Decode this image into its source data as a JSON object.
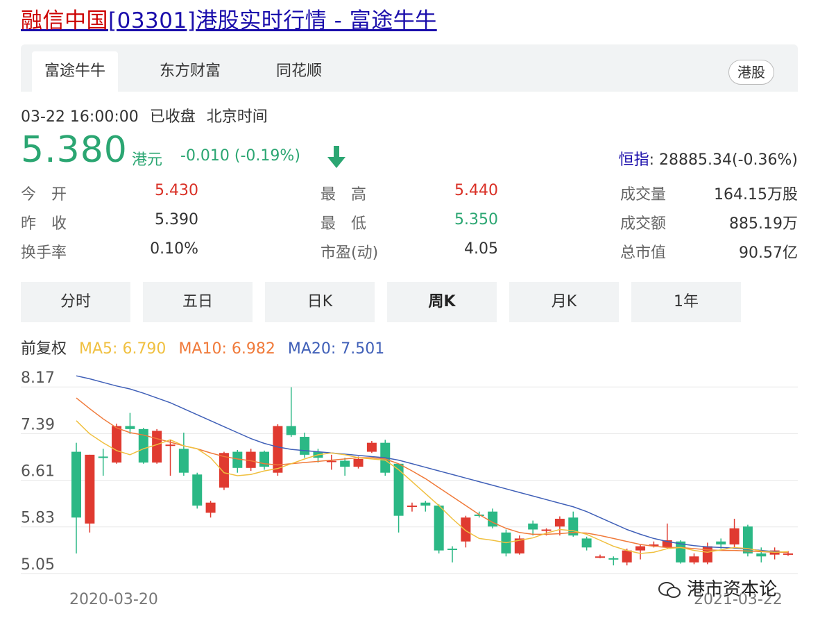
{
  "title": {
    "stock_name": "融信中国",
    "code": "[03301]",
    "rest": "港股实时行情 - 富途牛牛"
  },
  "source_tabs": [
    {
      "label": "富途牛牛",
      "active": true
    },
    {
      "label": "东方财富",
      "active": false
    },
    {
      "label": "同花顺",
      "active": false
    }
  ],
  "market_badge": "港股",
  "status": {
    "datetime": "03-22 16:00:00",
    "state": "已收盘",
    "tz": "北京时间"
  },
  "quote": {
    "price": "5.380",
    "unit": "港元",
    "change": "-0.010 (-0.19%)",
    "direction": "down"
  },
  "index": {
    "name": "恒指",
    "value": ": 28885.34(-0.36%)"
  },
  "stats": [
    {
      "label": "今　开",
      "value": "5.430",
      "tone": "red"
    },
    {
      "label": "最　高",
      "value": "5.440",
      "tone": "red"
    },
    {
      "label": "成交量",
      "value": "164.15万股",
      "tone": "normal"
    },
    {
      "label": "昨　收",
      "value": "5.390",
      "tone": "normal"
    },
    {
      "label": "最　低",
      "value": "5.350",
      "tone": "green"
    },
    {
      "label": "成交额",
      "value": "885.19万",
      "tone": "normal"
    },
    {
      "label": "换手率",
      "value": "0.10%",
      "tone": "normal"
    },
    {
      "label": "市盈(动)",
      "value": "4.05",
      "tone": "normal"
    },
    {
      "label": "总市值",
      "value": "90.57亿",
      "tone": "normal"
    }
  ],
  "period_tabs": [
    {
      "label": "分时",
      "active": false
    },
    {
      "label": "五日",
      "active": false
    },
    {
      "label": "日K",
      "active": false
    },
    {
      "label": "周K",
      "active": true
    },
    {
      "label": "月K",
      "active": false
    },
    {
      "label": "1年",
      "active": false
    }
  ],
  "legend": {
    "adjust": "前复权",
    "ma5": "MA5: 6.790",
    "ma10": "MA10: 6.982",
    "ma20": "MA20: 7.501"
  },
  "colors": {
    "up": "#e03a30",
    "down": "#2bb885",
    "ma5": "#f0c040",
    "ma10": "#f07a3a",
    "ma20": "#4060b8",
    "accent_green": "#2ba672",
    "link": "#1a0dab"
  },
  "watermark": "港市资本论",
  "chart_data": {
    "type": "candlestick",
    "period": "weekly",
    "y_ticks": [
      "8.17",
      "7.39",
      "6.61",
      "5.83",
      "5.05"
    ],
    "ylim": [
      4.7,
      8.3
    ],
    "x_labels": {
      "start": "2020-03-20",
      "end": "2021-03-22"
    },
    "candles": [
      [
        6.9,
        5.8,
        7.05,
        5.2,
        "down"
      ],
      [
        5.7,
        6.85,
        6.85,
        5.55,
        "up"
      ],
      [
        6.82,
        6.82,
        6.95,
        6.5,
        "flat"
      ],
      [
        6.72,
        7.33,
        7.37,
        6.7,
        "up"
      ],
      [
        7.33,
        7.28,
        7.55,
        7.2,
        "down"
      ],
      [
        7.28,
        6.72,
        7.3,
        6.7,
        "down"
      ],
      [
        6.72,
        7.25,
        7.28,
        6.7,
        "up"
      ],
      [
        7.02,
        7.02,
        7.1,
        6.5,
        "flat"
      ],
      [
        6.95,
        6.55,
        7.22,
        6.5,
        "down"
      ],
      [
        6.52,
        6.0,
        6.55,
        5.95,
        "down"
      ],
      [
        5.88,
        6.05,
        6.08,
        5.8,
        "up"
      ],
      [
        6.3,
        6.88,
        6.9,
        6.26,
        "up"
      ],
      [
        6.9,
        6.63,
        6.93,
        6.55,
        "down"
      ],
      [
        6.63,
        6.9,
        6.95,
        6.58,
        "up"
      ],
      [
        6.9,
        6.65,
        6.92,
        6.6,
        "down"
      ],
      [
        6.55,
        7.33,
        7.36,
        6.5,
        "up"
      ],
      [
        7.33,
        7.18,
        7.98,
        7.15,
        "down"
      ],
      [
        7.15,
        6.85,
        7.22,
        6.8,
        "down"
      ],
      [
        6.9,
        6.8,
        6.95,
        6.72,
        "down"
      ],
      [
        6.75,
        6.75,
        6.85,
        6.6,
        "flat"
      ],
      [
        6.75,
        6.65,
        6.8,
        6.5,
        "down"
      ],
      [
        6.65,
        6.78,
        6.82,
        6.62,
        "up"
      ],
      [
        6.9,
        7.05,
        7.08,
        6.88,
        "up"
      ],
      [
        7.05,
        6.55,
        7.1,
        6.5,
        "down"
      ],
      [
        6.7,
        5.83,
        6.7,
        5.55,
        "down"
      ],
      [
        6.0,
        6.0,
        6.05,
        5.9,
        "flat"
      ],
      [
        6.05,
        6.0,
        6.08,
        5.9,
        "down"
      ],
      [
        6.0,
        5.25,
        6.02,
        5.2,
        "down"
      ],
      [
        5.28,
        5.28,
        5.32,
        5.05,
        "flat"
      ],
      [
        5.4,
        5.8,
        5.83,
        5.3,
        "up"
      ],
      [
        5.85,
        5.85,
        5.9,
        5.8,
        "flat"
      ],
      [
        5.9,
        5.65,
        5.95,
        5.62,
        "down"
      ],
      [
        5.55,
        5.2,
        5.6,
        5.15,
        "down"
      ],
      [
        5.2,
        5.45,
        5.5,
        5.18,
        "up"
      ],
      [
        5.7,
        5.6,
        5.75,
        5.5,
        "down"
      ],
      [
        5.6,
        5.6,
        5.62,
        5.5,
        "flat"
      ],
      [
        5.65,
        5.78,
        5.82,
        5.5,
        "up"
      ],
      [
        5.8,
        5.5,
        5.9,
        5.48,
        "down"
      ],
      [
        5.45,
        5.3,
        5.48,
        5.25,
        "down"
      ],
      [
        5.15,
        5.15,
        5.18,
        5.12,
        "flat"
      ],
      [
        5.12,
        5.12,
        5.15,
        5.0,
        "flat"
      ],
      [
        5.05,
        5.25,
        5.28,
        5.0,
        "up"
      ],
      [
        5.25,
        5.32,
        5.35,
        5.1,
        "up"
      ],
      [
        5.35,
        5.35,
        5.4,
        5.3,
        "flat"
      ],
      [
        5.3,
        5.42,
        5.7,
        5.28,
        "up"
      ],
      [
        5.4,
        5.05,
        5.42,
        5.03,
        "down"
      ],
      [
        5.05,
        5.15,
        5.2,
        5.02,
        "up"
      ],
      [
        5.05,
        5.32,
        5.38,
        5.02,
        "up"
      ],
      [
        5.35,
        5.4,
        5.45,
        5.28,
        "flat"
      ],
      [
        5.35,
        5.62,
        5.78,
        5.3,
        "up"
      ],
      [
        5.65,
        5.2,
        5.68,
        5.15,
        "down"
      ],
      [
        5.2,
        5.15,
        5.3,
        5.05,
        "down"
      ],
      [
        5.18,
        5.25,
        5.3,
        5.1,
        "up"
      ],
      [
        5.2,
        5.2,
        5.24,
        5.16,
        "flat"
      ]
    ],
    "ma5": [
      7.42,
      7.2,
      7.05,
      6.92,
      6.85,
      6.95,
      7.02,
      7.1,
      7.0,
      6.95,
      6.8,
      6.55,
      6.5,
      6.52,
      6.58,
      6.62,
      6.7,
      6.78,
      6.85,
      6.88,
      6.85,
      6.8,
      6.78,
      6.76,
      6.6,
      6.4,
      6.2,
      6.0,
      5.78,
      5.58,
      5.45,
      5.42,
      5.38,
      5.42,
      5.46,
      5.54,
      5.6,
      5.58,
      5.52,
      5.42,
      5.32,
      5.25,
      5.2,
      5.22,
      5.28,
      5.3,
      5.25,
      5.22,
      5.26,
      5.3,
      5.28,
      5.24,
      5.22,
      5.23
    ],
    "ma10": [
      7.8,
      7.62,
      7.45,
      7.3,
      7.22,
      7.18,
      7.12,
      7.06,
      7.0,
      6.95,
      6.88,
      6.82,
      6.78,
      6.75,
      6.7,
      6.68,
      6.7,
      6.72,
      6.74,
      6.76,
      6.78,
      6.8,
      6.8,
      6.78,
      6.7,
      6.58,
      6.45,
      6.3,
      6.15,
      6.0,
      5.85,
      5.72,
      5.62,
      5.55,
      5.52,
      5.52,
      5.53,
      5.55,
      5.54,
      5.5,
      5.45,
      5.4,
      5.35,
      5.32,
      5.3,
      5.3,
      5.28,
      5.26,
      5.25,
      5.25,
      5.24,
      5.23,
      5.22,
      5.22
    ],
    "ma20": [
      8.17,
      8.12,
      8.06,
      8.0,
      7.95,
      7.88,
      7.8,
      7.72,
      7.62,
      7.52,
      7.42,
      7.32,
      7.22,
      7.12,
      7.04,
      6.98,
      6.94,
      6.92,
      6.9,
      6.88,
      6.86,
      6.84,
      6.82,
      6.8,
      6.76,
      6.7,
      6.64,
      6.58,
      6.52,
      6.46,
      6.4,
      6.34,
      6.28,
      6.22,
      6.16,
      6.1,
      6.04,
      5.98,
      5.9,
      5.8,
      5.7,
      5.6,
      5.52,
      5.45,
      5.4,
      5.36,
      5.33,
      5.31,
      5.3,
      5.29,
      5.27,
      5.25,
      5.23,
      5.22
    ]
  }
}
